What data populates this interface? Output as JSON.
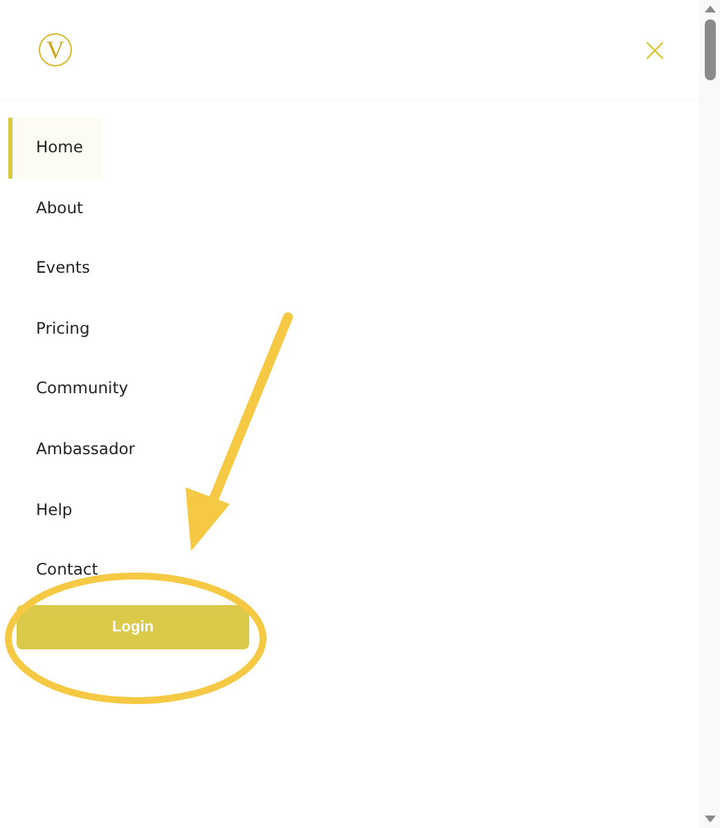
{
  "logo": {
    "letter": "V"
  },
  "close": {
    "glyph": "×"
  },
  "nav": [
    {
      "label": "Home",
      "selected": true
    },
    {
      "label": "About",
      "selected": false
    },
    {
      "label": "Events",
      "selected": false
    },
    {
      "label": "Pricing",
      "selected": false
    },
    {
      "label": "Community",
      "selected": false
    },
    {
      "label": "Ambassador",
      "selected": false
    },
    {
      "label": "Help",
      "selected": false
    },
    {
      "label": "Contact",
      "selected": false
    }
  ],
  "login_button": {
    "label": "Login"
  }
}
